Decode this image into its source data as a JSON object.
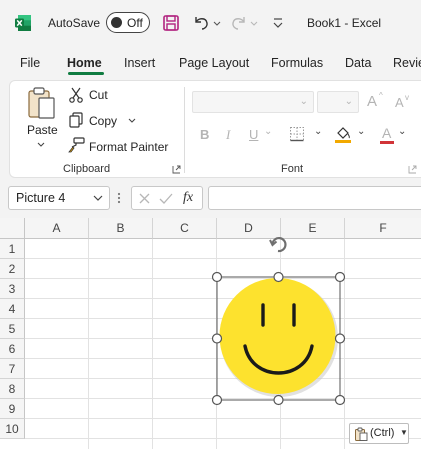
{
  "titlebar": {
    "autosave_label": "AutoSave",
    "autosave_state": "Off",
    "document_title": "Book1  -  Excel",
    "icons": [
      "excel-logo-icon",
      "save-icon",
      "undo-icon",
      "redo-icon",
      "customize-qat-icon"
    ]
  },
  "tabs": [
    {
      "label": "File"
    },
    {
      "label": "Home",
      "active": true
    },
    {
      "label": "Insert"
    },
    {
      "label": "Page Layout"
    },
    {
      "label": "Formulas"
    },
    {
      "label": "Data"
    },
    {
      "label": "Revie"
    }
  ],
  "ribbon": {
    "clipboard": {
      "group_label": "Clipboard",
      "paste_label": "Paste",
      "cut_label": "Cut",
      "copy_label": "Copy",
      "format_painter_label": "Format Painter"
    },
    "font": {
      "group_label": "Font",
      "font_name": "",
      "font_size": "",
      "bold": "B",
      "italic": "I",
      "underline": "U",
      "grow": "A",
      "shrink": "A"
    }
  },
  "formula_bar": {
    "name_box": "Picture 4",
    "fx_label": "fx",
    "formula": ""
  },
  "grid": {
    "columns": [
      "A",
      "B",
      "C",
      "D",
      "E",
      "F"
    ],
    "rows": [
      "1",
      "2",
      "3",
      "4",
      "5",
      "6",
      "7",
      "8",
      "9",
      "10"
    ]
  },
  "picture": {
    "name": "smiley-face",
    "fill_color": "#fde22e",
    "stroke_color": "#1a1a1a"
  },
  "paste_options": {
    "label": "(Ctrl)"
  },
  "colors": {
    "accent": "#107c41",
    "fill_bucket": "#f2a900",
    "font_color_bar": "#d13438"
  }
}
